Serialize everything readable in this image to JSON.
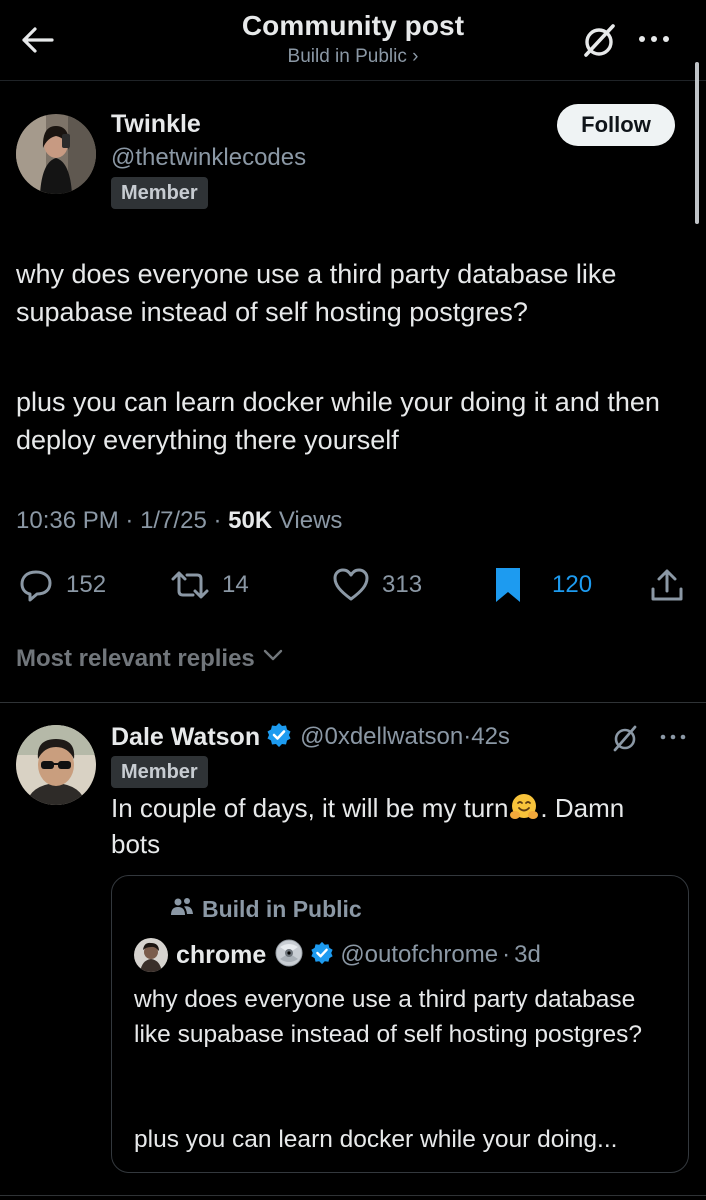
{
  "header": {
    "title": "Community post",
    "subtitle": "Build in Public ›"
  },
  "post": {
    "author_name": "Twinkle",
    "author_handle": "@thetwinklecodes",
    "badge": "Member",
    "follow_label": "Follow",
    "paragraph1": "why does everyone use a third party database like supabase instead of self hosting postgres?",
    "paragraph2": "plus you can learn docker while your doing it and then deploy everything there yourself",
    "time": "10:36 PM",
    "date": "1/7/25",
    "views_count": "50K",
    "views_label": "Views",
    "stats": {
      "replies": "152",
      "reposts": "14",
      "likes": "313",
      "bookmarks": "120"
    }
  },
  "replies_sort": {
    "label": "Most relevant replies"
  },
  "reply": {
    "author_name": "Dale Watson",
    "author_handle": "@0xdellwatson",
    "time": "42s",
    "badge": "Member",
    "text_before_emoji": "In couple of days, it will be my turn",
    "text_after_emoji": ". Damn bots",
    "quote": {
      "community": "Build in Public",
      "author_name": "chrome",
      "author_handle": "@outofchrome",
      "time": "3d",
      "paragraph1": "why does everyone use a third party database like supabase instead of self hosting postgres?",
      "paragraph2": "plus you can learn docker while your doing..."
    }
  },
  "colors": {
    "background": "#000000",
    "text": "#e7e9ea",
    "muted": "#8b98a5",
    "accent": "#1d9bf0",
    "badge_bg": "#2f3336"
  },
  "icons": [
    "back-arrow-icon",
    "grok-icon",
    "more-icon",
    "reply-icon",
    "repost-icon",
    "like-icon",
    "bookmark-icon",
    "share-icon",
    "chevron-down-icon",
    "verified-icon",
    "community-icon",
    "disc-icon",
    "hugging-face-emoji"
  ]
}
